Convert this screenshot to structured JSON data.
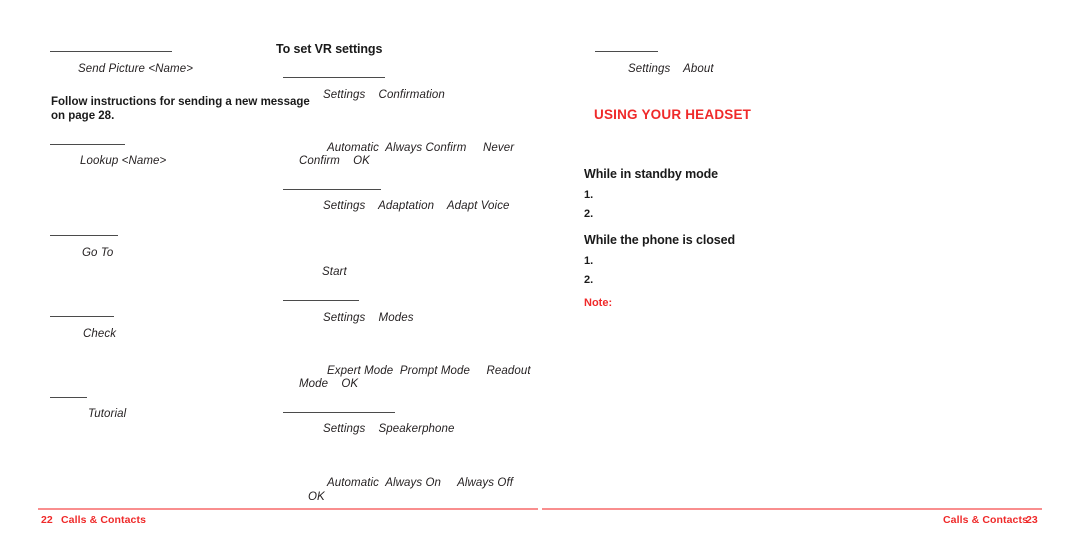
{
  "document": {
    "type": "printed-manual-spread",
    "accent_color": "#ef2a2a",
    "rule_color": "#4b4b4b",
    "text_color": "#231f20"
  },
  "left_page": {
    "entries": [
      {
        "label": "Send Picture <Name>"
      },
      {
        "label": "Lookup <Name>"
      },
      {
        "label": "Go To"
      },
      {
        "label": "Check"
      },
      {
        "label": "Tutorial"
      }
    ],
    "note_paragraph": "Follow instructions for sending a new message\non page 28."
  },
  "middle_column": {
    "heading": "To set VR settings",
    "blocks": [
      {
        "path": "Settings    Confirmation"
      },
      {
        "options_line1": "Automatic  Always Confirm     Never",
        "options_line2": "Confirm    OK"
      },
      {
        "path": "Settings    Adaptation    Adapt Voice"
      },
      {
        "start": "Start"
      },
      {
        "path": "Settings    Modes"
      },
      {
        "options_line1": "Expert Mode  Prompt Mode     Readout",
        "options_line2": "Mode    OK"
      },
      {
        "path": "Settings    Speakerphone"
      },
      {
        "options_line1": "Automatic  Always On     Always Off",
        "options_line2": "OK"
      }
    ]
  },
  "right_page": {
    "about_path": "Settings    About",
    "section_title": "USING YOUR HEADSET",
    "subsections": [
      {
        "heading": "While in standby mode",
        "steps": [
          "1.",
          "2."
        ]
      },
      {
        "heading": "While the phone is closed",
        "steps": [
          "1.",
          "2."
        ]
      }
    ],
    "note_label": "Note:"
  },
  "footer": {
    "left_page_number": "22",
    "left_chapter": "Calls & Contacts",
    "right_chapter": "Calls & Contacts",
    "right_page_number": "23"
  }
}
